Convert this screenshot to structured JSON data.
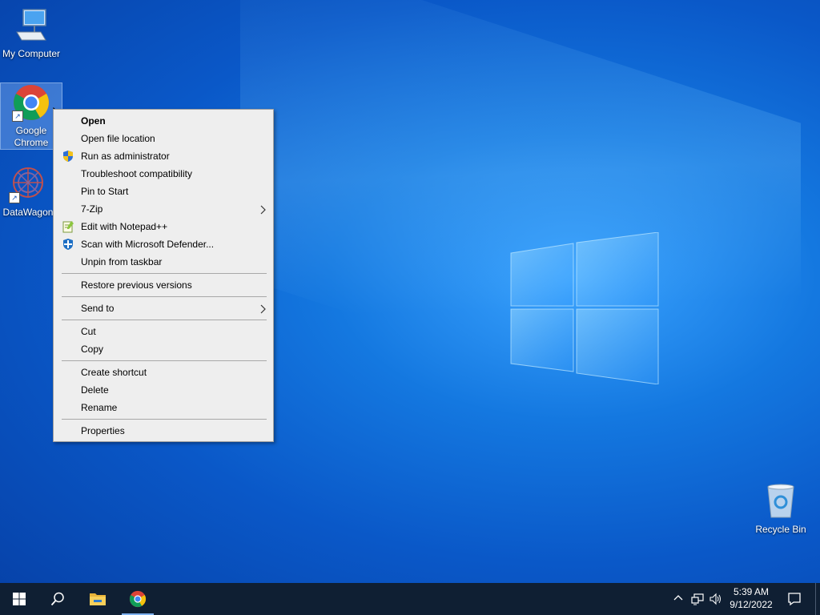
{
  "desktop_icons": {
    "my_computer": "My Computer",
    "chrome_line1": "Google",
    "chrome_line2": "Chrome",
    "datawagon": "DataWagon",
    "recycle_bin": "Recycle Bin"
  },
  "context_menu": {
    "open": "Open",
    "open_file_location": "Open file location",
    "run_as_admin": "Run as administrator",
    "troubleshoot": "Troubleshoot compatibility",
    "pin_to_start": "Pin to Start",
    "seven_zip": "7-Zip",
    "edit_notepad": "Edit with Notepad++",
    "scan_defender": "Scan with Microsoft Defender...",
    "unpin_taskbar": "Unpin from taskbar",
    "restore_versions": "Restore previous versions",
    "send_to": "Send to",
    "cut": "Cut",
    "copy": "Copy",
    "create_shortcut": "Create shortcut",
    "delete": "Delete",
    "rename": "Rename",
    "properties": "Properties",
    "submenu_arrow": ">"
  },
  "taskbar": {
    "time": "5:39 AM",
    "date": "9/12/2022",
    "tray_chevron": "^"
  },
  "colors": {
    "taskbar_bg": "#0f1f33",
    "menu_bg": "#eeeeee",
    "desktop_blue": "#0a58c8"
  }
}
